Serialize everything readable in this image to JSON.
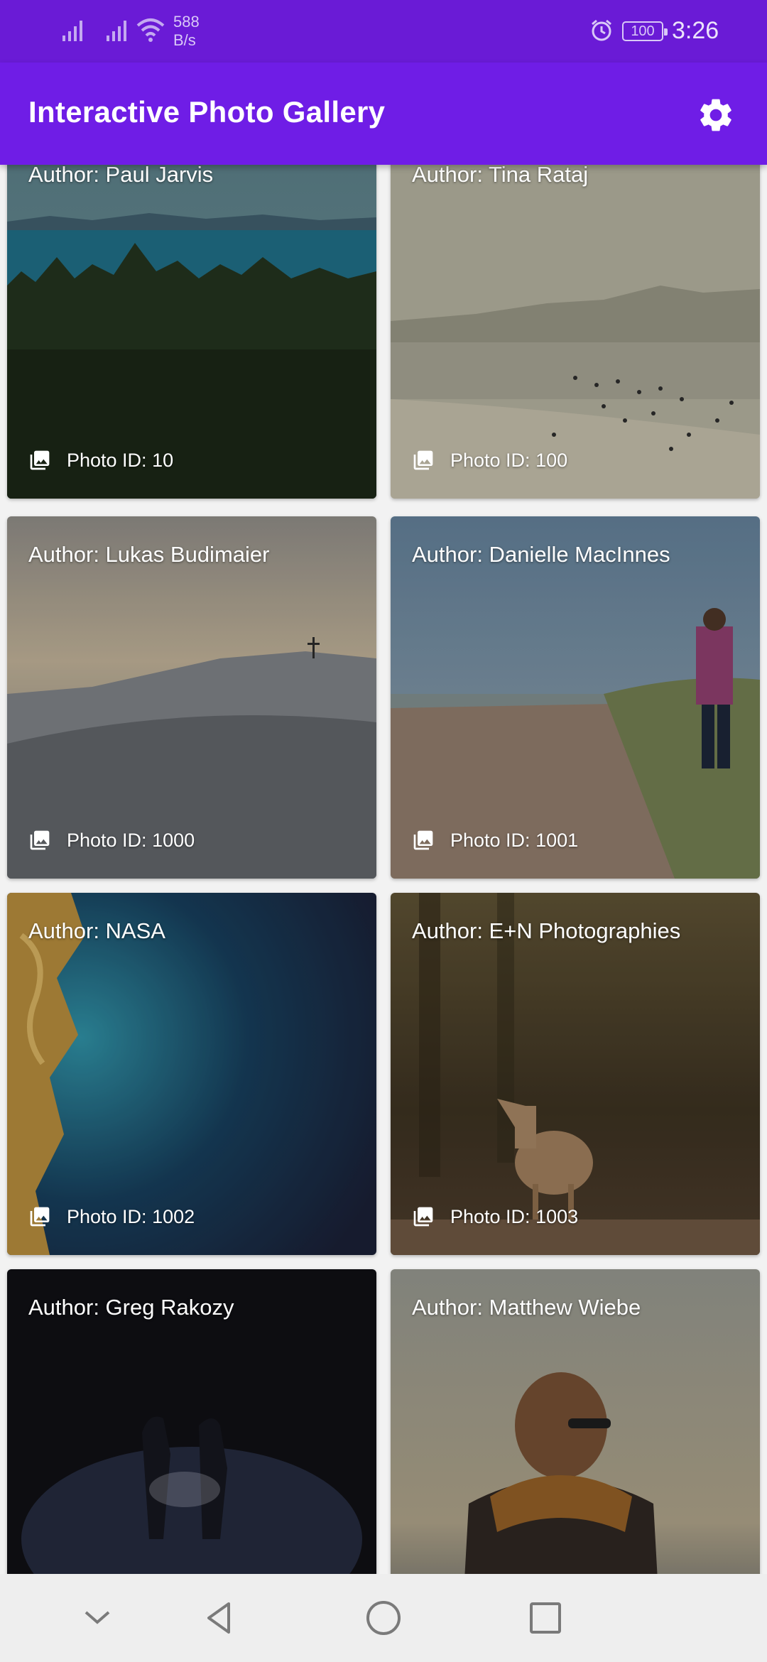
{
  "status_bar": {
    "net_speed_value": "588",
    "net_speed_unit": "B/s",
    "battery": "100",
    "time": "3:26"
  },
  "app_bar": {
    "title": "Interactive Photo Gallery",
    "settings_icon": "gear-icon"
  },
  "gallery": {
    "photo_icon": "image-icon",
    "cards": [
      {
        "author": "Author: Paul Jarvis",
        "photo_id": "Photo ID: 10"
      },
      {
        "author": "Author: Tina Rataj",
        "photo_id": "Photo ID: 100"
      },
      {
        "author": "Author: Lukas Budimaier",
        "photo_id": "Photo ID: 1000"
      },
      {
        "author": "Author: Danielle MacInnes",
        "photo_id": "Photo ID: 1001"
      },
      {
        "author": "Author: NASA",
        "photo_id": "Photo ID: 1002"
      },
      {
        "author": "Author: E+N Photographies",
        "photo_id": "Photo ID: 1003"
      },
      {
        "author": "Author: Greg Rakozy",
        "photo_id": ""
      },
      {
        "author": "Author: Matthew Wiebe",
        "photo_id": ""
      }
    ]
  },
  "colors": {
    "primary": "#6f1de6",
    "status_bar": "#6a1bd6",
    "nav_bar": "#eeeeee"
  },
  "nav_bar": {
    "icons": [
      "chevron-down-icon",
      "back-icon",
      "home-icon",
      "recents-icon"
    ]
  }
}
